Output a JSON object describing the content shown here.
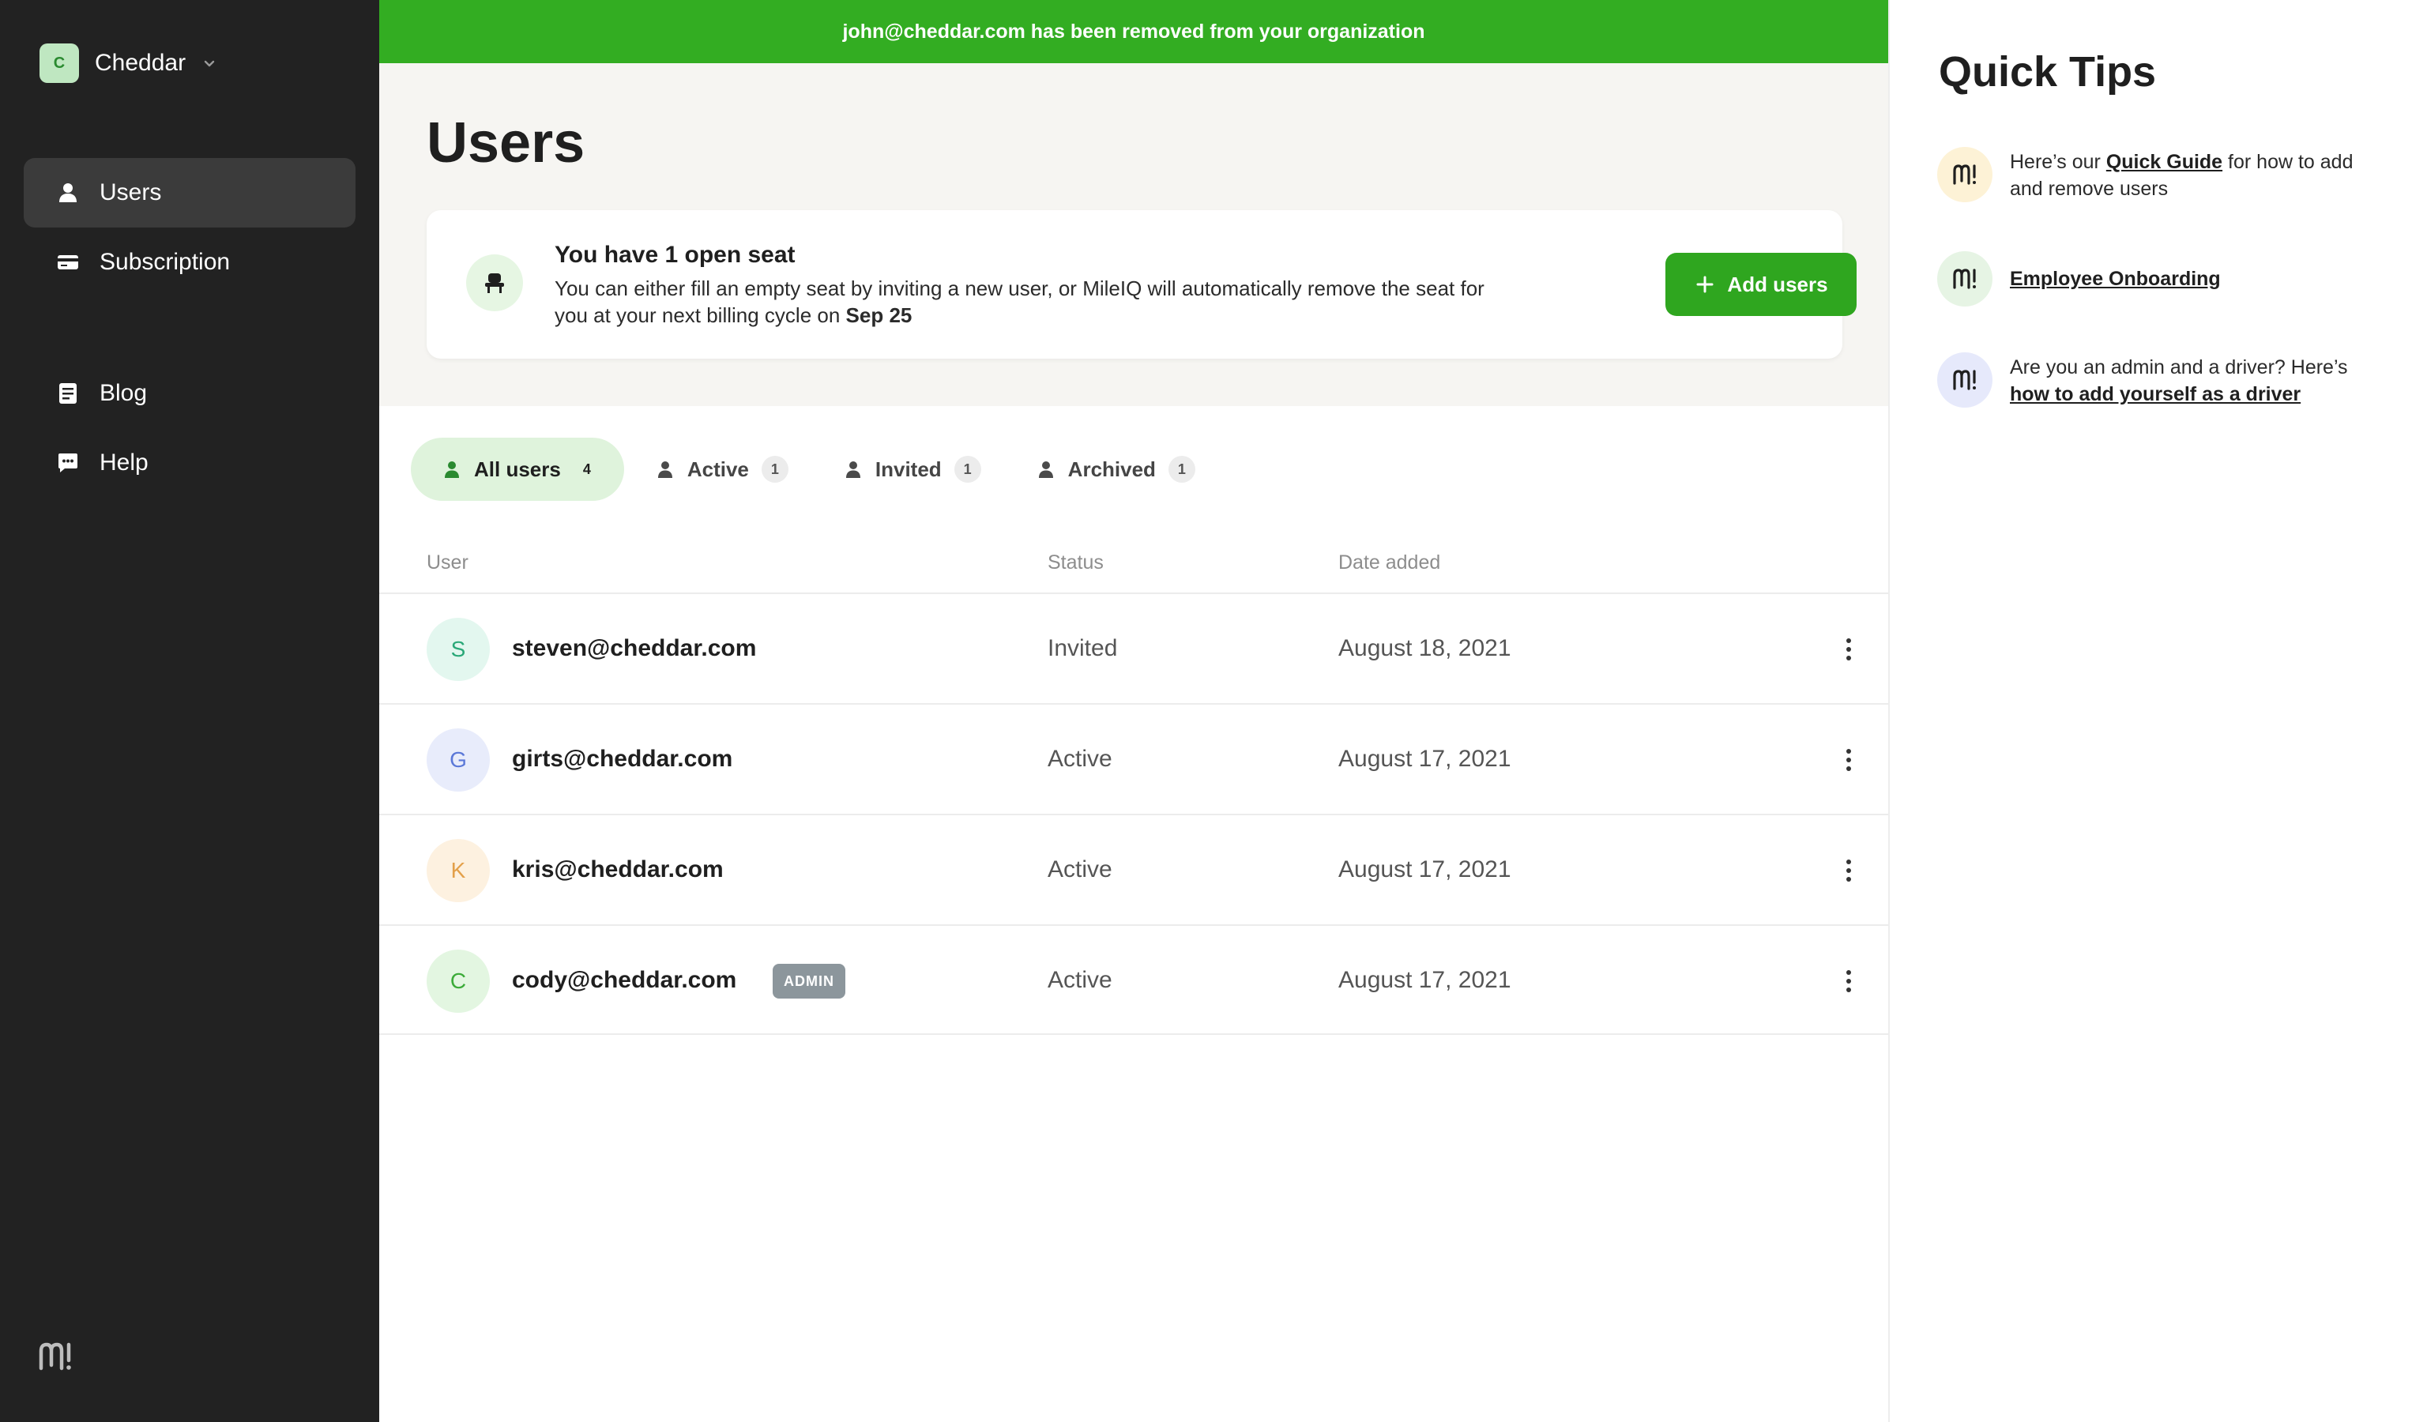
{
  "sidebar": {
    "org": {
      "initial": "C",
      "name": "Cheddar"
    },
    "nav": [
      {
        "label": "Users",
        "icon": "user-icon",
        "active": true
      },
      {
        "label": "Subscription",
        "icon": "credit-card-icon",
        "active": false
      },
      {
        "label": "Blog",
        "icon": "document-icon",
        "active": false
      },
      {
        "label": "Help",
        "icon": "chat-icon",
        "active": false
      }
    ],
    "brand_icon": "mileiq-logo-icon"
  },
  "toast": {
    "message": "john@cheddar.com has been removed from your organization",
    "color": "#33ad22"
  },
  "page": {
    "title": "Users"
  },
  "seat_card": {
    "title": "You have 1 open seat",
    "description_prefix": "You can either fill an empty seat by inviting a new user, or MileIQ will automatically remove the seat for you at your next billing cycle on ",
    "description_date": "Sep 25",
    "add_button": "Add users"
  },
  "tabs": [
    {
      "label": "All users",
      "count": "4",
      "active": true
    },
    {
      "label": "Active",
      "count": "1",
      "active": false
    },
    {
      "label": "Invited",
      "count": "1",
      "active": false
    },
    {
      "label": "Archived",
      "count": "1",
      "active": false
    }
  ],
  "table": {
    "columns": {
      "user": "User",
      "status": "Status",
      "date": "Date added"
    },
    "rows": [
      {
        "initial": "S",
        "email": "steven@cheddar.com",
        "badge": "",
        "status": "Invited",
        "date": "August 18, 2021",
        "avatar_bg": "#e3f7ef",
        "avatar_fg": "#2aa878"
      },
      {
        "initial": "G",
        "email": "girts@cheddar.com",
        "badge": "",
        "status": "Active",
        "date": "August 17, 2021",
        "avatar_bg": "#e8ecfb",
        "avatar_fg": "#5b78d8"
      },
      {
        "initial": "K",
        "email": "kris@cheddar.com",
        "badge": "",
        "status": "Active",
        "date": "August 17, 2021",
        "avatar_bg": "#fdf1e0",
        "avatar_fg": "#e3a04a"
      },
      {
        "initial": "C",
        "email": "cody@cheddar.com",
        "badge": "ADMIN",
        "status": "Active",
        "date": "August 17, 2021",
        "avatar_bg": "#e3f6e1",
        "avatar_fg": "#3cab39"
      }
    ]
  },
  "tips": {
    "title": "Quick Tips",
    "items": [
      {
        "pre": "Here’s our ",
        "link": "Quick Guide",
        "post": " for how to add and remove users",
        "bg": "#fdf2d6"
      },
      {
        "pre": "",
        "link": "Employee Onboarding",
        "post": "",
        "bg": "#e6f4e4"
      },
      {
        "pre": "Are you an admin and a driver? Here’s ",
        "link": "how to add yourself as a driver",
        "post": "",
        "bg": "#e6e9fb"
      }
    ]
  }
}
